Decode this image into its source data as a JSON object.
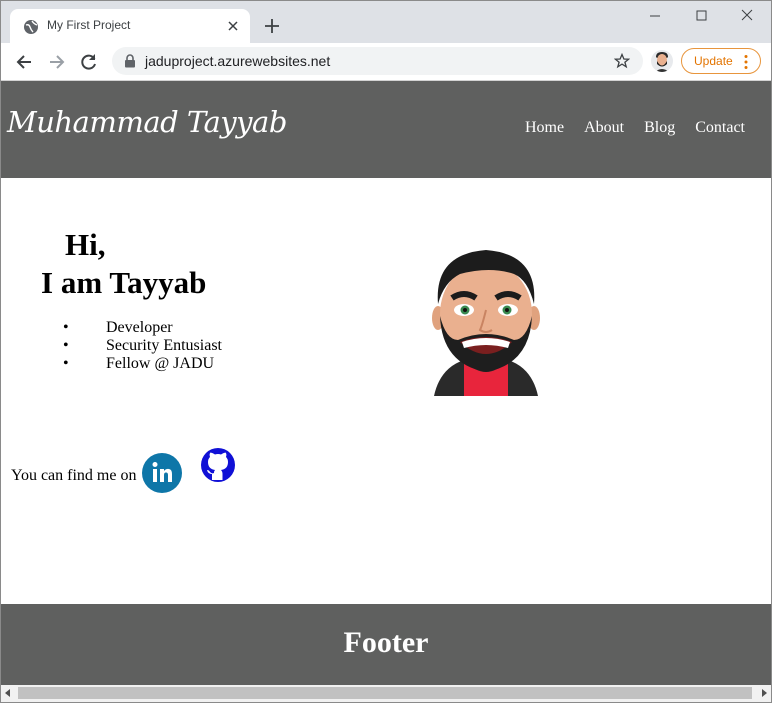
{
  "browser": {
    "tab_title": "My First Project",
    "url": "jaduproject.azurewebsites.net",
    "update_label": "Update"
  },
  "site": {
    "logo": "Muhammad Tayyab",
    "nav": [
      "Home",
      "About",
      "Blog",
      "Contact"
    ],
    "greeting_line1": "Hi,",
    "greeting_line2": "I am Tayyab",
    "roles": [
      "Developer",
      "Security Entusiast",
      "Fellow @ JADU"
    ],
    "find_me": "You can find me on",
    "footer": "Footer"
  },
  "colors": {
    "header_bg": "#5f605f",
    "linkedin": "#0e76a8",
    "github": "#1010d6",
    "update_accent": "#e37400"
  },
  "icons": [
    "globe-icon",
    "close-icon",
    "plus-icon",
    "minimize-icon",
    "maximize-icon",
    "window-close-icon",
    "back-icon",
    "forward-icon",
    "reload-icon",
    "lock-icon",
    "star-icon",
    "more-icon",
    "linkedin-icon",
    "github-icon"
  ]
}
